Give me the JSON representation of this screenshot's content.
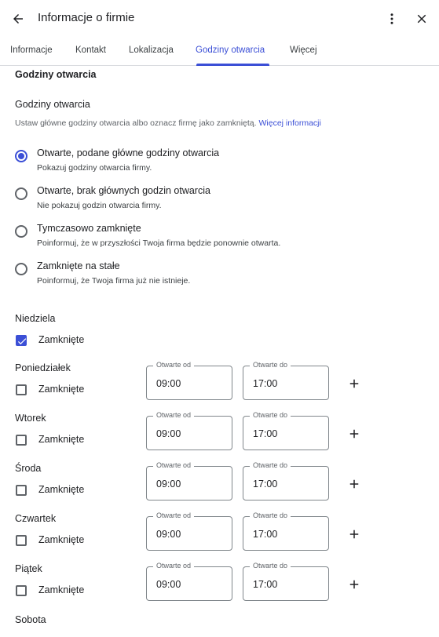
{
  "header": {
    "title": "Informacje o firmie"
  },
  "tabs": [
    {
      "label": "Informacje"
    },
    {
      "label": "Kontakt"
    },
    {
      "label": "Lokalizacja"
    },
    {
      "label": "Godziny otwarcia"
    },
    {
      "label": "Więcej"
    }
  ],
  "active_tab": "Godziny otwarcia",
  "section_title": "Godziny otwarcia",
  "hours": {
    "heading": "Godziny otwarcia",
    "description": "Ustaw główne godziny otwarcia albo oznacz firmę jako zamkniętą.",
    "link": "Więcej informacji",
    "options": [
      {
        "label": "Otwarte, podane główne godziny otwarcia",
        "sub": "Pokazuj godziny otwarcia firmy.",
        "selected": true
      },
      {
        "label": "Otwarte, brak głównych godzin otwarcia",
        "sub": "Nie pokazuj godzin otwarcia firmy.",
        "selected": false
      },
      {
        "label": "Tymczasowo zamknięte",
        "sub": "Poinformuj, że w przyszłości Twoja firma będzie ponownie otwarta.",
        "selected": false
      },
      {
        "label": "Zamknięte na stałe",
        "sub": "Poinformuj, że Twoja firma już nie istnieje.",
        "selected": false
      }
    ]
  },
  "days": {
    "sunday": {
      "name": "Niedziela",
      "closed_label": "Zamknięte",
      "closed": true
    },
    "list": [
      {
        "name": "Poniedziałek",
        "closed_label": "Zamknięte",
        "closed": false,
        "from_label": "Otwarte od",
        "from": "09:00",
        "to_label": "Otwarte do",
        "to": "17:00"
      },
      {
        "name": "Wtorek",
        "closed_label": "Zamknięte",
        "closed": false,
        "from_label": "Otwarte od",
        "from": "09:00",
        "to_label": "Otwarte do",
        "to": "17:00"
      },
      {
        "name": "Środa",
        "closed_label": "Zamknięte",
        "closed": false,
        "from_label": "Otwarte od",
        "from": "09:00",
        "to_label": "Otwarte do",
        "to": "17:00"
      },
      {
        "name": "Czwartek",
        "closed_label": "Zamknięte",
        "closed": false,
        "from_label": "Otwarte od",
        "from": "09:00",
        "to_label": "Otwarte do",
        "to": "17:00"
      },
      {
        "name": "Piątek",
        "closed_label": "Zamknięte",
        "closed": false,
        "from_label": "Otwarte od",
        "from": "09:00",
        "to_label": "Otwarte do",
        "to": "17:00"
      }
    ],
    "saturday": {
      "name": "Sobota"
    }
  },
  "icons": {
    "back": "arrow-back-icon",
    "more": "more-vert-icon",
    "close": "close-icon",
    "add": "plus-icon",
    "check": "check-icon"
  },
  "colors": {
    "accent": "#3b4fd6",
    "text": "#202124",
    "secondary": "#5f6368",
    "border": "#80868b"
  }
}
